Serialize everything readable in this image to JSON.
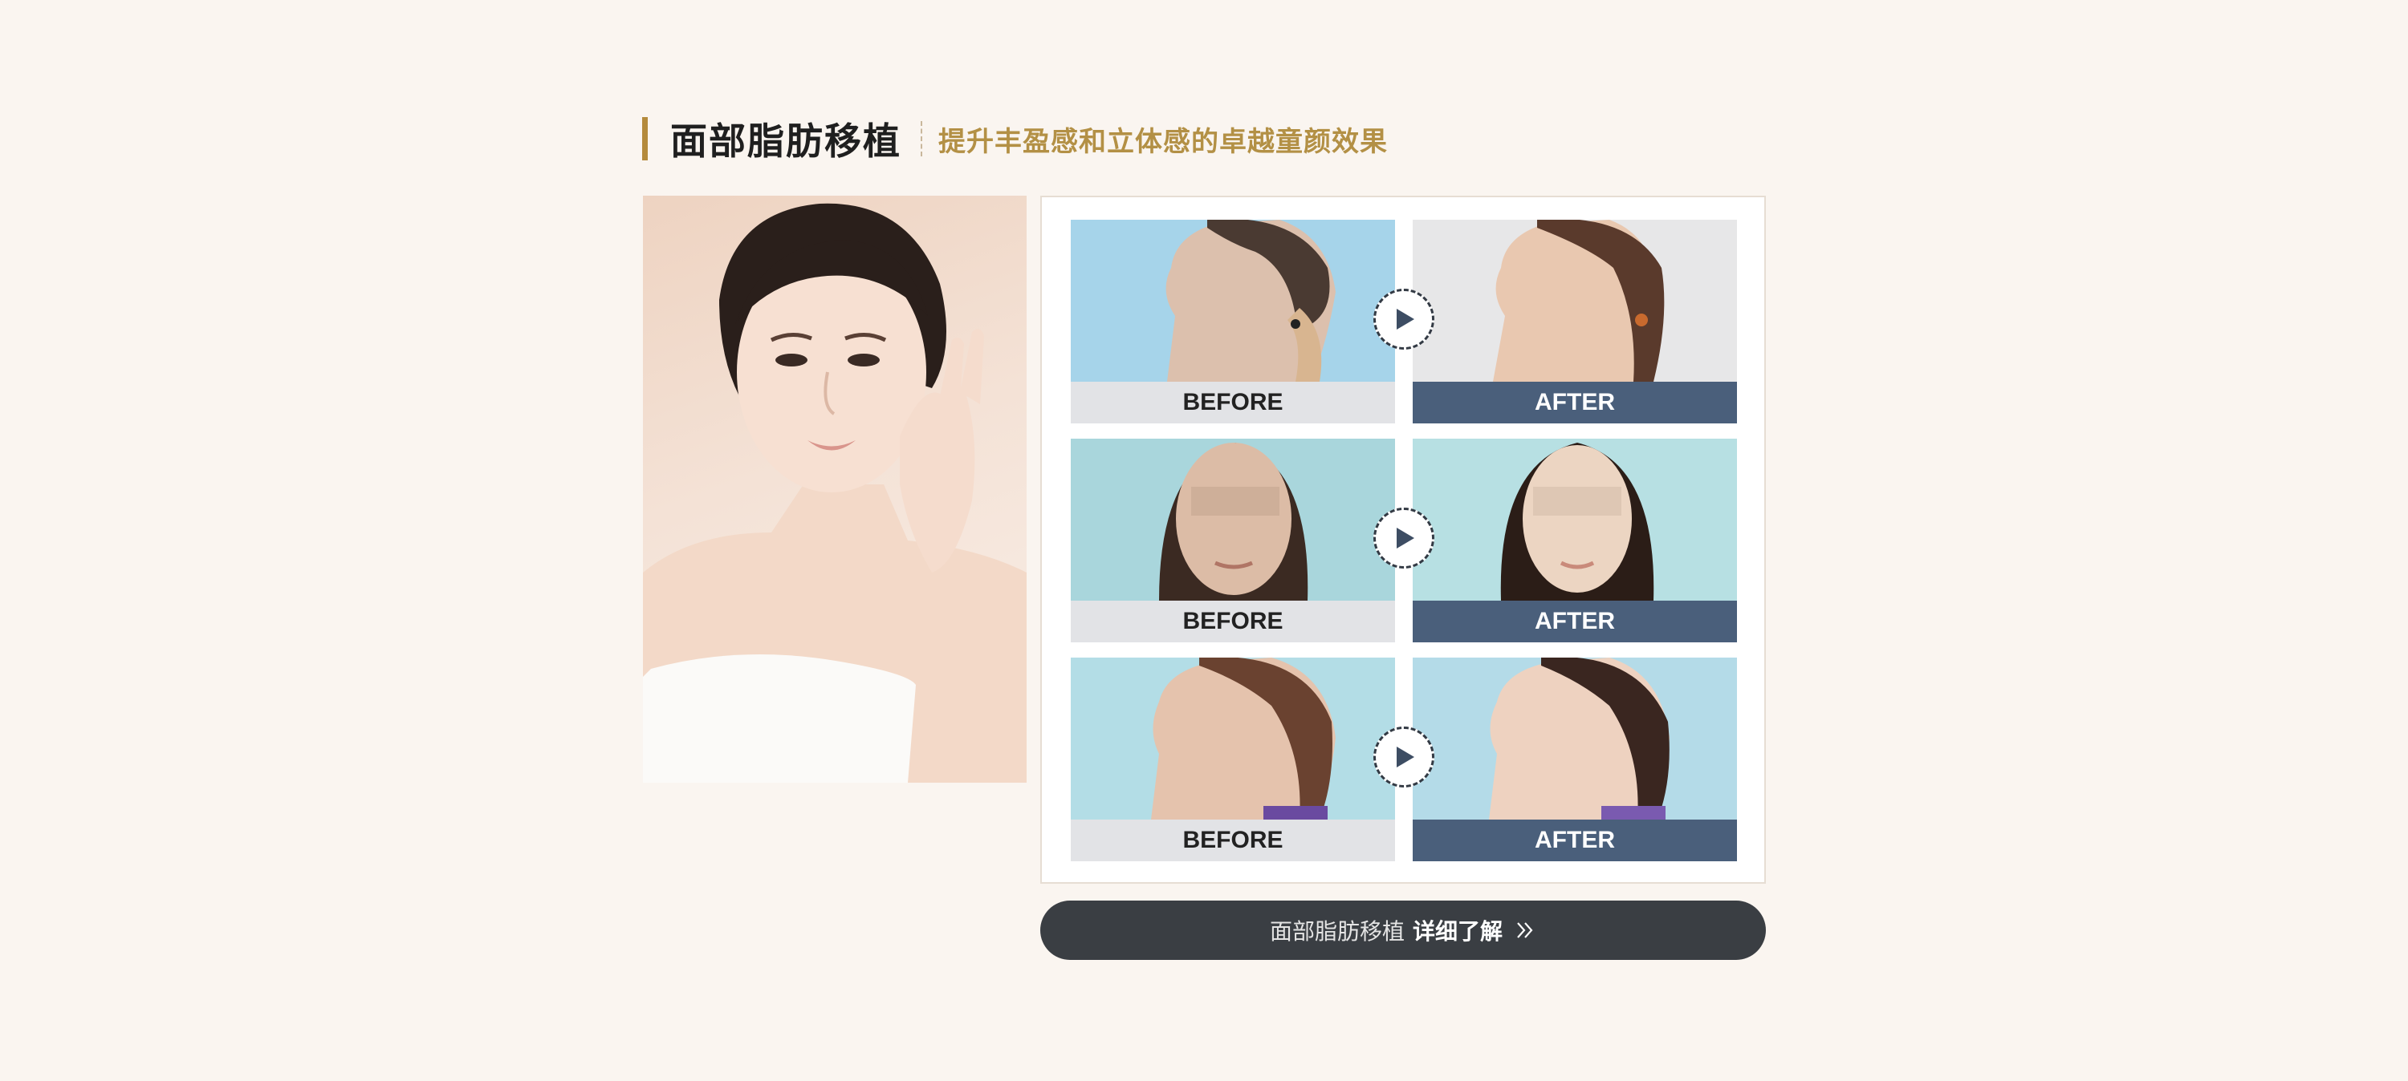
{
  "header": {
    "title": "面部脂肪移植",
    "subtitle": "提升丰盈感和立体感的卓越童颜效果"
  },
  "comparisons": [
    {
      "before_label": "BEFORE",
      "after_label": "AFTER",
      "view": "side-profile-right"
    },
    {
      "before_label": "BEFORE",
      "after_label": "AFTER",
      "view": "front"
    },
    {
      "before_label": "BEFORE",
      "after_label": "AFTER",
      "view": "side-profile-left"
    }
  ],
  "cta": {
    "label_light": "面部脂肪移植",
    "label_bold": "详细了解",
    "icon": "double-chevron-right-icon"
  },
  "colors": {
    "background": "#faf5f0",
    "accent_gold": "#b39045",
    "after_label_bg": "#4a5f7b",
    "before_label_bg": "#e2e3e6",
    "cta_bg": "#3a3e43"
  }
}
